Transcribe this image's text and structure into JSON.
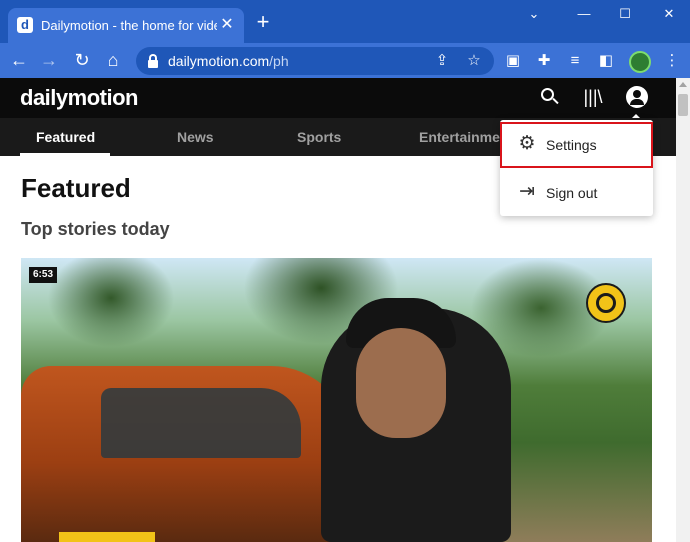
{
  "browser": {
    "tab_title": "Dailymotion - the home for videos",
    "tab_favicon_letter": "d",
    "tab_close_glyph": "✕",
    "new_tab_glyph": "+",
    "url_host": "dailymotion.com",
    "url_path": "/ph",
    "window_controls": {
      "minimize": "—",
      "maximize": "☐",
      "close": "✕",
      "chevron": "⌄"
    },
    "nav_icons": {
      "back": "←",
      "forward": "→",
      "reload": "↻",
      "home": "⌂"
    },
    "omnibox_icons": {
      "share": "⇪",
      "bookmark": "☆"
    },
    "extension_icons": [
      "▣",
      "✚",
      "≡",
      "◧"
    ]
  },
  "site": {
    "logo": "dailymotion",
    "library_glyph": "|||\\",
    "categories": [
      {
        "label": "Featured",
        "active": true
      },
      {
        "label": "News",
        "active": false
      },
      {
        "label": "Sports",
        "active": false
      },
      {
        "label": "Entertainment",
        "active": false
      }
    ]
  },
  "content": {
    "title": "Featured",
    "subtitle": "Top stories today",
    "video": {
      "duration": "6:53"
    }
  },
  "dropdown": {
    "items": [
      {
        "label": "Settings",
        "icon": "gear-icon",
        "glyph": "⚙",
        "highlighted": true
      },
      {
        "label": "Sign out",
        "icon": "sign-out-icon",
        "glyph": "⇥",
        "highlighted": false
      }
    ]
  },
  "colors": {
    "chrome_dark": "#1f57b8",
    "chrome_light": "#3c72d6",
    "site_header": "#0b0b0b",
    "category_bar": "#1a1a1a",
    "highlight_border": "#d9141b"
  }
}
